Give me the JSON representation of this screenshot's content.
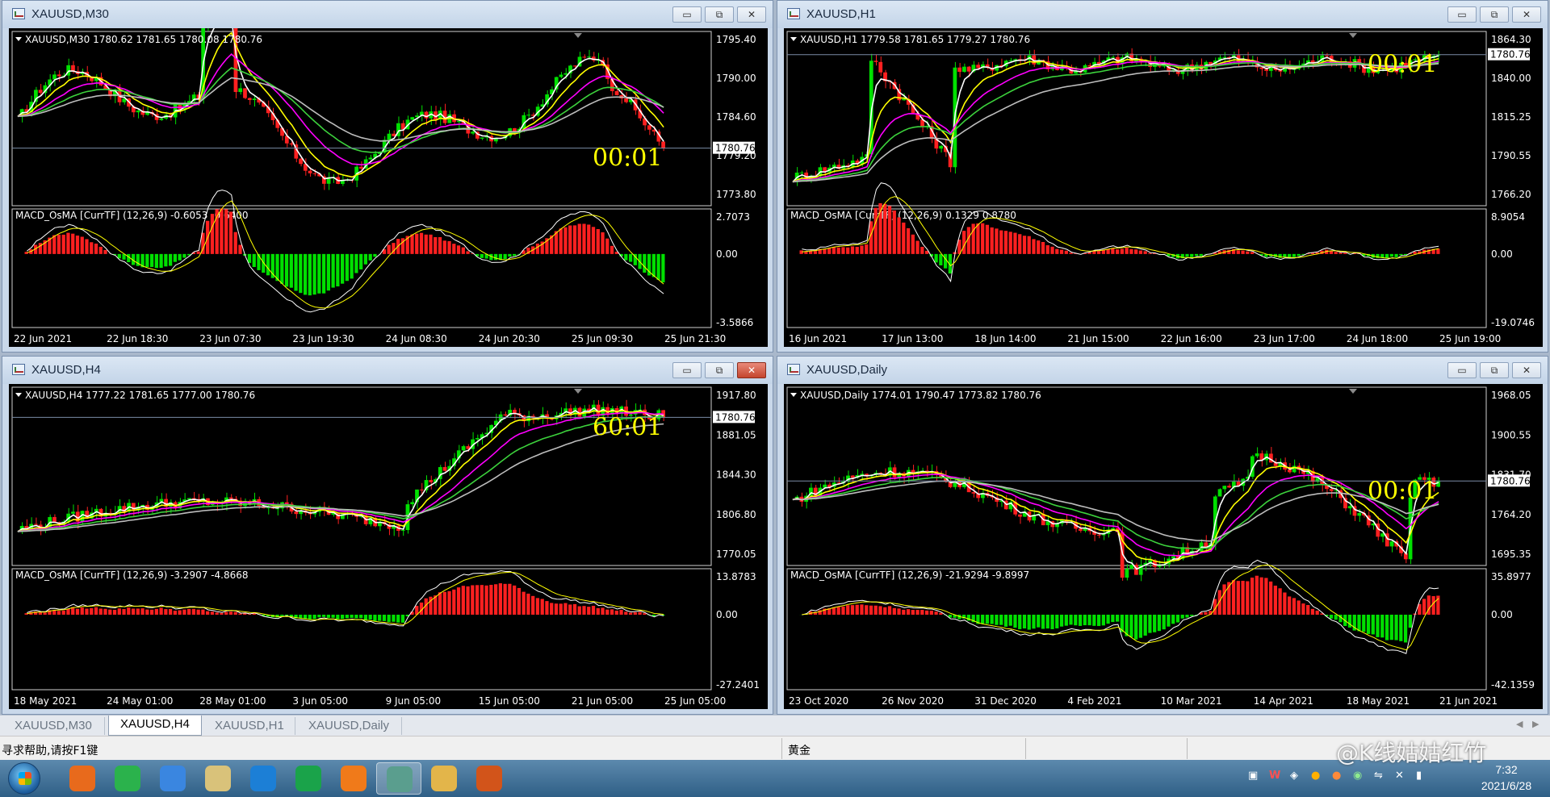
{
  "windows": [
    {
      "title": "XAUUSD,M30",
      "ohlc_label": "XAUUSD,M30  1780.62 1781.65 1780.08 1780.76",
      "price_ticks": [
        "1795.40",
        "1790.00",
        "1784.60",
        "1779.20",
        "1773.80"
      ],
      "price_range": [
        1771,
        1797
      ],
      "current_price": "1780.76",
      "countdown": "00:01",
      "macd_label": "MACD_OsMA [CurrTF] (12,26,9) -0.6053 -0.6400",
      "macd_ticks": [
        "2.7073",
        "0.00",
        "-3.5866"
      ],
      "date_ticks": [
        "22 Jun 2021",
        "22 Jun 18:30",
        "23 Jun 07:30",
        "23 Jun 19:30",
        "24 Jun 08:30",
        "24 Jun 20:30",
        "25 Jun 09:30",
        "25 Jun 21:30"
      ],
      "max_color": "#c8c8c8",
      "close_active": false
    },
    {
      "title": "XAUUSD,H1",
      "ohlc_label": "XAUUSD,H1  1779.58 1781.65 1779.27 1780.76",
      "price_ticks": [
        "1864.30",
        "1840.00",
        "1815.25",
        "1790.55",
        "1766.20"
      ],
      "price_range": [
        1757,
        1869
      ],
      "current_price": "1780.76",
      "countdown": "00:01",
      "macd_label": "MACD_OsMA [CurrTF] (12,26,9) 0.1329 0.8780",
      "macd_ticks": [
        "8.9054",
        "0.00",
        "-19.0746"
      ],
      "date_ticks": [
        "16 Jun 2021",
        "17 Jun 13:00",
        "18 Jun 14:00",
        "21 Jun 15:00",
        "22 Jun 16:00",
        "23 Jun 17:00",
        "24 Jun 18:00",
        "25 Jun 19:00"
      ],
      "close_active": false
    },
    {
      "title": "XAUUSD,H4",
      "ohlc_label": "XAUUSD,H4  1777.22 1781.65 1777.00 1780.76",
      "price_ticks": [
        "1917.80",
        "1881.05",
        "1844.30",
        "1806.80",
        "1770.05"
      ],
      "price_range": [
        1758,
        1925
      ],
      "current_price": "1780.76",
      "countdown": "60:01",
      "macd_label": "MACD_OsMA [CurrTF] (12,26,9) -3.2907 -4.8668",
      "macd_ticks": [
        "13.8783",
        "0.00",
        "-27.2401"
      ],
      "date_ticks": [
        "18 May 2021",
        "24 May 01:00",
        "28 May 01:00",
        "3 Jun 05:00",
        "9 Jun 05:00",
        "15 Jun 05:00",
        "21 Jun 05:00",
        "25 Jun 05:00"
      ],
      "close_active": true
    },
    {
      "title": "XAUUSD,Daily",
      "ohlc_label": "XAUUSD,Daily  1774.01 1790.47 1773.82 1780.76",
      "price_ticks": [
        "1968.05",
        "1900.55",
        "1831.70",
        "1764.20",
        "1695.35"
      ],
      "price_range": [
        1670,
        1980
      ],
      "current_price": "1780.76",
      "countdown": "00:01",
      "macd_label": "MACD_OsMA [CurrTF] (12,26,9) -21.9294 -9.8997",
      "macd_ticks": [
        "35.8977",
        "0.00",
        "-42.1359"
      ],
      "date_ticks": [
        "23 Oct 2020",
        "26 Nov 2020",
        "31 Dec 2020",
        "4 Feb 2021",
        "10 Mar 2021",
        "14 Apr 2021",
        "18 May 2021",
        "21 Jun 2021"
      ],
      "close_active": false
    }
  ],
  "window_buttons": {
    "minimize": "▭",
    "maximize": "⧉",
    "close": "✕"
  },
  "tabs": [
    "XAUUSD,M30",
    "XAUUSD,H4",
    "XAUUSD,H1",
    "XAUUSD,Daily"
  ],
  "active_tab": "XAUUSD,H4",
  "tab_scroll": {
    "left": "◀",
    "right": "▶"
  },
  "status": {
    "help": "寻求帮助,请按F1键",
    "symbol_name": "黄金"
  },
  "clock": {
    "time": "7:32",
    "date": "2021/6/28"
  },
  "watermark": "@K线姑姑红竹",
  "taskbar_apps": [
    {
      "name": "start-button"
    },
    {
      "name": "orange-app-icon",
      "color": "#e86a1c"
    },
    {
      "name": "wechat-icon",
      "color": "#2bb24c"
    },
    {
      "name": "blue-pen-app-icon",
      "color": "#3a86e0"
    },
    {
      "name": "paint-app-icon",
      "color": "#d9c27a"
    },
    {
      "name": "blue-mountain-app-icon",
      "color": "#1c7fd6"
    },
    {
      "name": "green-circle-app-icon",
      "color": "#1aa34a"
    },
    {
      "name": "firefox-icon",
      "color": "#f07a1a"
    },
    {
      "name": "trading-terminal-icon",
      "color": "#5a9e8e",
      "active": true
    },
    {
      "name": "folder-icon",
      "color": "#e3b54a"
    },
    {
      "name": "raccoon-app-icon",
      "color": "#d2541a"
    }
  ],
  "colors": {
    "bull_candle": "#00e000",
    "bear_candle": "#ff2020",
    "ma_fast": "#ffffff",
    "ma_yellow": "#ffff00",
    "ma_magenta": "#ff00ff",
    "ma_green": "#3cd23c",
    "ma_gray": "#bdbdbd",
    "countdown": "#ffff00",
    "chart_bg": "#000000",
    "axis_text": "#ffffff"
  }
}
